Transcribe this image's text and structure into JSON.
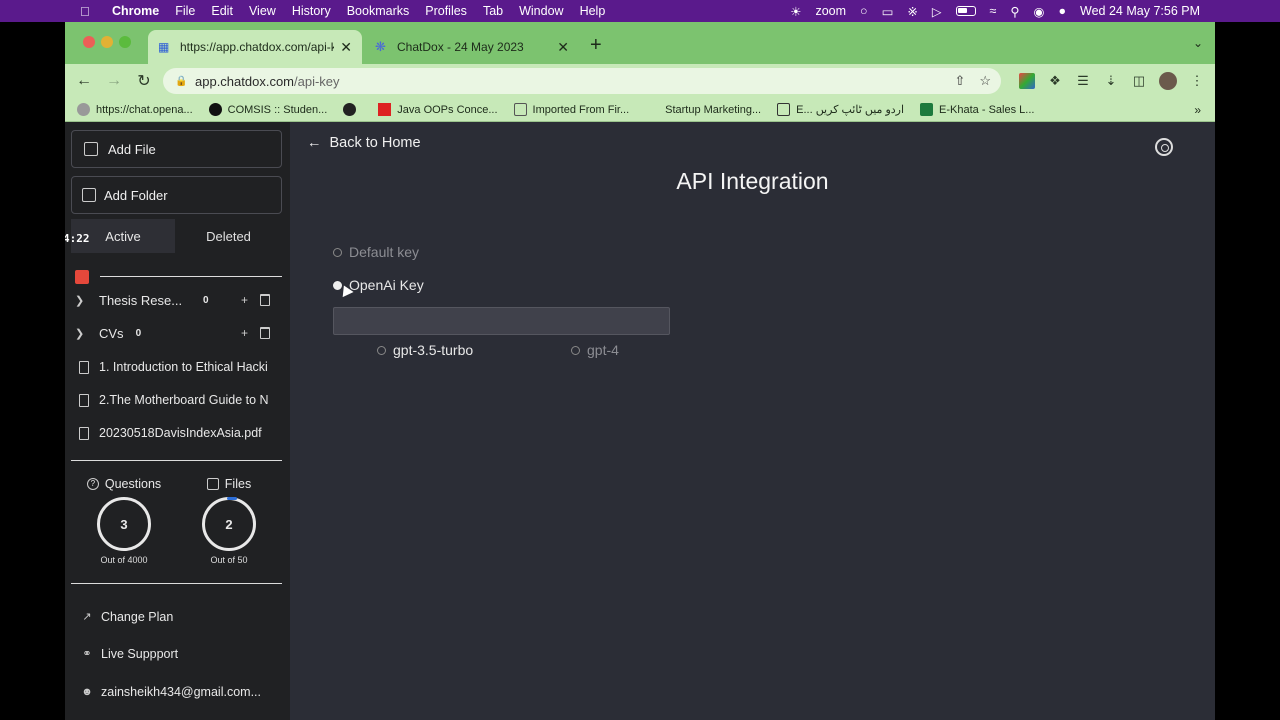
{
  "menubar": {
    "app_name": "Chrome",
    "items": [
      "File",
      "Edit",
      "View",
      "History",
      "Bookmarks",
      "Profiles",
      "Tab",
      "Window",
      "Help"
    ],
    "zoom": "zoom",
    "datetime": "Wed 24 May  7:56 PM"
  },
  "browser": {
    "tabs": [
      {
        "title": "https://app.chatdox.com/api-k"
      },
      {
        "title": "ChatDox - 24 May 2023"
      }
    ],
    "url_host": "app.chatdox.com",
    "url_path": "/api-key",
    "bookmarks": [
      "https://chat.opena...",
      "COMSIS :: Studen...",
      "",
      "Java OOPs Conce...",
      "Imported From Fir...",
      "Startup Marketing...",
      "E... اردو میں ٹائپ کریں",
      "E-Khata - Sales L..."
    ]
  },
  "sidebar": {
    "add_file": "Add File",
    "add_folder": "Add Folder",
    "timer": "4:22",
    "tab_active": "Active",
    "tab_deleted": "Deleted",
    "folders": [
      {
        "name": "Thesis Rese...",
        "count": "0"
      },
      {
        "name": "CVs",
        "count": "0"
      }
    ],
    "files": [
      {
        "name": "1. Introduction to Ethical Hacki"
      },
      {
        "name": "2.The Motherboard Guide to N"
      },
      {
        "name": "20230518DavisIndexAsia.pdf"
      }
    ],
    "stats": {
      "questions_label": "Questions",
      "questions_value": "3",
      "questions_sub": "Out of 4000",
      "files_label": "Files",
      "files_value": "2",
      "files_sub": "Out of 50"
    },
    "change_plan": "Change Plan",
    "live_support": "Live Suppport",
    "user_email": "zainsheikh434@gmail.com..."
  },
  "main": {
    "back_label": "Back to Home",
    "title": "API Integration",
    "options": {
      "default_key": "Default key",
      "openai_key": "OpenAi Key",
      "model_a": "gpt-3.5-turbo",
      "model_b": "gpt-4"
    },
    "key_value": ""
  },
  "colors": {
    "menubar": "#5a1a8c",
    "tabbar": "#7cc36f",
    "toolbar": "#c7e9b8",
    "sidebar": "#202123",
    "main": "#2b2d36",
    "accent_red": "#e5483b",
    "ring_accent": "#2e6fd8"
  }
}
